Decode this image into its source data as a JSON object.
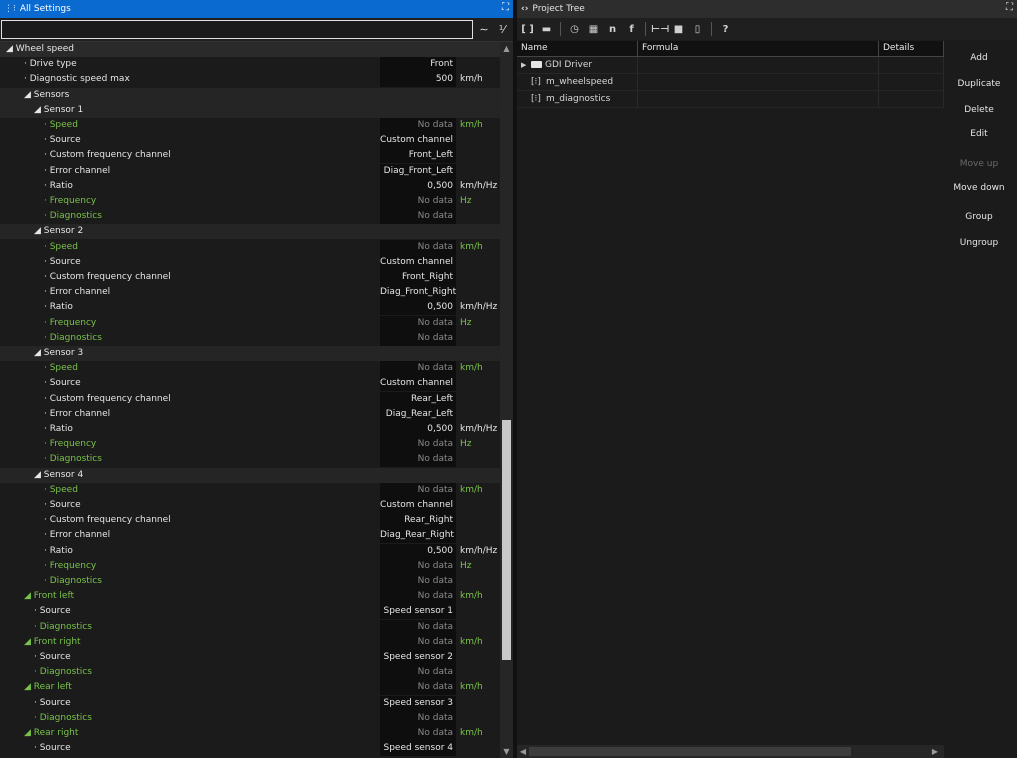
{
  "left_panel": {
    "title": "All Settings",
    "filter": {
      "value": "",
      "placeholder": ""
    },
    "rows": [
      {
        "label": "◢ Wheel speed",
        "indent": 0,
        "style": "group",
        "color": "white"
      },
      {
        "label": "· Drive type",
        "indent": 1,
        "value": "Front",
        "color": "white"
      },
      {
        "label": "· Diagnostic speed max",
        "indent": 1,
        "value": "500",
        "unit": "km/h",
        "color": "white"
      },
      {
        "label": "◢ Sensors",
        "indent": 1,
        "style": "subgroup",
        "color": "white"
      },
      {
        "label": "◢ Sensor 1",
        "indent": 2,
        "style": "subgroup",
        "color": "white"
      },
      {
        "label": "· Speed",
        "indent": 3,
        "value": "No data",
        "unit": "km/h",
        "color": "green"
      },
      {
        "label": "· Source",
        "indent": 3,
        "value": "Custom channel",
        "color": "white"
      },
      {
        "label": "· Custom frequency channel",
        "indent": 3,
        "value": "Front_Left",
        "color": "white"
      },
      {
        "label": "· Error channel",
        "indent": 3,
        "value": "Diag_Front_Left",
        "color": "white"
      },
      {
        "label": "· Ratio",
        "indent": 3,
        "value": "0,500",
        "unit": "km/h/Hz",
        "color": "white"
      },
      {
        "label": "· Frequency",
        "indent": 3,
        "value": "No data",
        "unit": "Hz",
        "color": "green"
      },
      {
        "label": "· Diagnostics",
        "indent": 3,
        "value": "No data",
        "color": "green"
      },
      {
        "label": "◢ Sensor 2",
        "indent": 2,
        "style": "subgroup",
        "color": "white"
      },
      {
        "label": "· Speed",
        "indent": 3,
        "value": "No data",
        "unit": "km/h",
        "color": "green"
      },
      {
        "label": "· Source",
        "indent": 3,
        "value": "Custom channel",
        "color": "white"
      },
      {
        "label": "· Custom frequency channel",
        "indent": 3,
        "value": "Front_Right",
        "color": "white"
      },
      {
        "label": "· Error channel",
        "indent": 3,
        "value": "Diag_Front_Right",
        "color": "white"
      },
      {
        "label": "· Ratio",
        "indent": 3,
        "value": "0,500",
        "unit": "km/h/Hz",
        "color": "white"
      },
      {
        "label": "· Frequency",
        "indent": 3,
        "value": "No data",
        "unit": "Hz",
        "color": "green"
      },
      {
        "label": "· Diagnostics",
        "indent": 3,
        "value": "No data",
        "color": "green"
      },
      {
        "label": "◢ Sensor 3",
        "indent": 2,
        "style": "subgroup",
        "color": "white"
      },
      {
        "label": "· Speed",
        "indent": 3,
        "value": "No data",
        "unit": "km/h",
        "color": "green"
      },
      {
        "label": "· Source",
        "indent": 3,
        "value": "Custom channel",
        "color": "white"
      },
      {
        "label": "· Custom frequency channel",
        "indent": 3,
        "value": "Rear_Left",
        "color": "white"
      },
      {
        "label": "· Error channel",
        "indent": 3,
        "value": "Diag_Rear_Left",
        "color": "white"
      },
      {
        "label": "· Ratio",
        "indent": 3,
        "value": "0,500",
        "unit": "km/h/Hz",
        "color": "white"
      },
      {
        "label": "· Frequency",
        "indent": 3,
        "value": "No data",
        "unit": "Hz",
        "color": "green"
      },
      {
        "label": "· Diagnostics",
        "indent": 3,
        "value": "No data",
        "color": "green"
      },
      {
        "label": "◢ Sensor 4",
        "indent": 2,
        "style": "subgroup",
        "color": "white"
      },
      {
        "label": "· Speed",
        "indent": 3,
        "value": "No data",
        "unit": "km/h",
        "color": "green"
      },
      {
        "label": "· Source",
        "indent": 3,
        "value": "Custom channel",
        "color": "white"
      },
      {
        "label": "· Custom frequency channel",
        "indent": 3,
        "value": "Rear_Right",
        "color": "white"
      },
      {
        "label": "· Error channel",
        "indent": 3,
        "value": "Diag_Rear_Right",
        "color": "white"
      },
      {
        "label": "· Ratio",
        "indent": 3,
        "value": "0,500",
        "unit": "km/h/Hz",
        "color": "white"
      },
      {
        "label": "· Frequency",
        "indent": 3,
        "value": "No data",
        "unit": "Hz",
        "color": "green"
      },
      {
        "label": "· Diagnostics",
        "indent": 3,
        "value": "No data",
        "color": "green"
      },
      {
        "label": "◢ Front left",
        "indent": 1,
        "value": "No data",
        "unit": "km/h",
        "color": "green"
      },
      {
        "label": "· Source",
        "indent": 2,
        "value": "Speed sensor 1",
        "color": "white"
      },
      {
        "label": "· Diagnostics",
        "indent": 2,
        "value": "No data",
        "color": "green"
      },
      {
        "label": "◢ Front right",
        "indent": 1,
        "value": "No data",
        "unit": "km/h",
        "color": "green"
      },
      {
        "label": "· Source",
        "indent": 2,
        "value": "Speed sensor 2",
        "color": "white"
      },
      {
        "label": "· Diagnostics",
        "indent": 2,
        "value": "No data",
        "color": "green"
      },
      {
        "label": "◢ Rear left",
        "indent": 1,
        "value": "No data",
        "unit": "km/h",
        "color": "green"
      },
      {
        "label": "· Source",
        "indent": 2,
        "value": "Speed sensor 3",
        "color": "white"
      },
      {
        "label": "· Diagnostics",
        "indent": 2,
        "value": "No data",
        "color": "green"
      },
      {
        "label": "◢ Rear right",
        "indent": 1,
        "value": "No data",
        "unit": "km/h",
        "color": "green"
      },
      {
        "label": "· Source",
        "indent": 2,
        "value": "Speed sensor 4",
        "color": "white"
      }
    ]
  },
  "right_panel": {
    "title": "Project Tree",
    "toolbar_icons": [
      "variable-icon",
      "film-icon",
      "timer-icon",
      "table-icon",
      "n-icon",
      "f-icon",
      "split-icon",
      "folder-icon",
      "file-icon",
      "help-icon"
    ],
    "columns": [
      "Name",
      "Formula",
      "Details"
    ],
    "tree": [
      {
        "name": "GDI Driver",
        "type": "folder",
        "formula": "",
        "details": ""
      },
      {
        "name": "m_wheelspeed",
        "type": "variable",
        "formula": "",
        "details": ""
      },
      {
        "name": "m_diagnostics",
        "type": "variable",
        "formula": "",
        "details": ""
      }
    ],
    "buttons": [
      {
        "label": "Add",
        "enabled": true
      },
      {
        "label": "Duplicate",
        "enabled": true
      },
      {
        "label": "Delete",
        "enabled": true
      },
      {
        "label": "Edit",
        "enabled": true
      },
      {
        "label": "Move up",
        "enabled": false
      },
      {
        "label": "Move down",
        "enabled": true
      },
      {
        "label": "Group",
        "enabled": true
      },
      {
        "label": "Ungroup",
        "enabled": true
      }
    ]
  },
  "colors": {
    "accent": "#0a6ad0",
    "green": "#79c24a",
    "grey": "#8a8a8a"
  }
}
